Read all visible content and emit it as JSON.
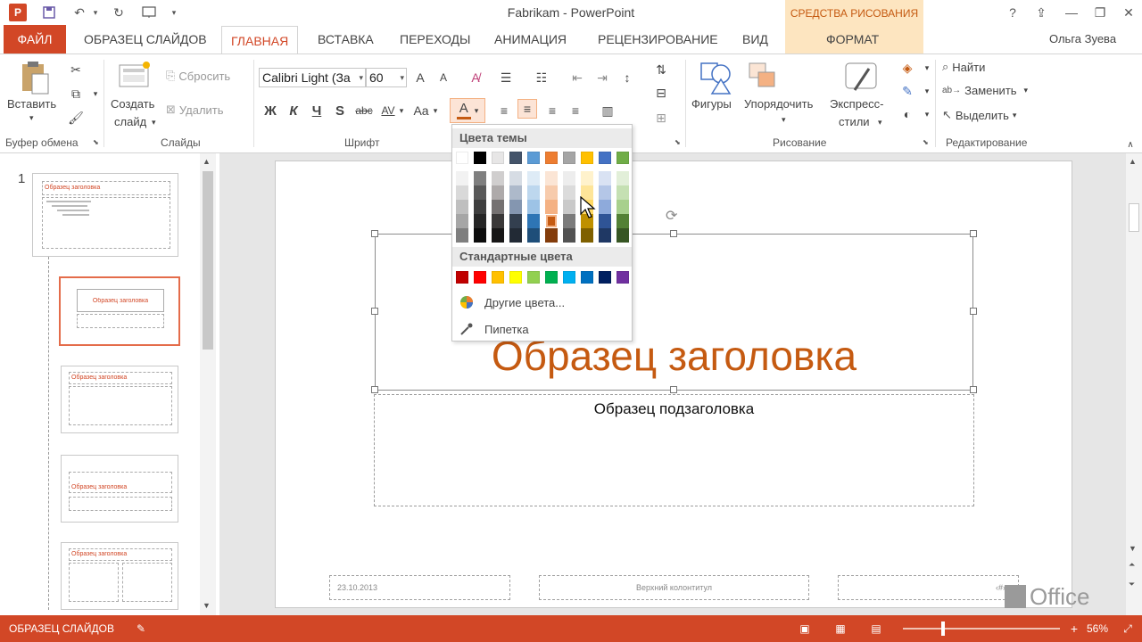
{
  "app": {
    "logo_letter": "P",
    "window_title": "Fabrikam - PowerPoint",
    "context_group": "СРЕДСТВА РИСОВАНИЯ",
    "user": "Ольга Зуева",
    "help": "?",
    "colors": {
      "accent": "#d24726",
      "title_orange": "#c55a11",
      "context_bg": "#fde5c0"
    }
  },
  "tabs": [
    {
      "label": "ФАЙЛ"
    },
    {
      "label": "ОБРАЗЕЦ СЛАЙДОВ"
    },
    {
      "label": "ГЛАВНАЯ"
    },
    {
      "label": "ВСТАВКА"
    },
    {
      "label": "ПЕРЕХОДЫ"
    },
    {
      "label": "АНИМАЦИЯ"
    },
    {
      "label": "РЕЦЕНЗИРОВАНИЕ"
    },
    {
      "label": "ВИД"
    },
    {
      "label": "ФОРМАТ"
    }
  ],
  "ribbon": {
    "clipboard": {
      "paste": "Вставить",
      "label": "Буфер обмена"
    },
    "slides": {
      "new_slide_line1": "Создать",
      "new_slide_line2": "слайд",
      "reset": "Сбросить",
      "delete": "Удалить",
      "label": "Слайды"
    },
    "font": {
      "font_name": "Calibri Light (За",
      "font_size": "60",
      "grow": "A",
      "shrink": "A",
      "bold": "Ж",
      "italic": "К",
      "underline": "Ч",
      "shadow": "S",
      "strike": "abc",
      "spacing": "AV",
      "case": "Aa",
      "color_letter": "A",
      "label": "Шрифт"
    },
    "drawing": {
      "shapes": "Фигуры",
      "arrange": "Упорядочить",
      "quick_styles_line1": "Экспресс-",
      "quick_styles_line2": "стили",
      "label": "Рисование"
    },
    "editing": {
      "find": "Найти",
      "replace": "Заменить",
      "select": "Выделить",
      "label": "Редактирование"
    }
  },
  "color_menu": {
    "theme_heading": "Цвета темы",
    "standard_heading": "Стандартные цвета",
    "more_colors": "Другие цвета...",
    "eyedropper": "Пипетка",
    "theme_top_row": [
      "#ffffff",
      "#000000",
      "#e7e6e6",
      "#44546a",
      "#5b9bd5",
      "#ed7d31",
      "#a5a5a5",
      "#ffc000",
      "#4472c4",
      "#70ad47"
    ],
    "theme_shades": [
      [
        "#f2f2f2",
        "#d9d9d9",
        "#bfbfbf",
        "#a6a6a6",
        "#7f7f7f"
      ],
      [
        "#7f7f7f",
        "#595959",
        "#3f3f3f",
        "#262626",
        "#0d0d0d"
      ],
      [
        "#d0cece",
        "#aeaaaa",
        "#757171",
        "#3a3838",
        "#171616"
      ],
      [
        "#d6dce4",
        "#adb9ca",
        "#8496b0",
        "#333f4f",
        "#222a35"
      ],
      [
        "#deebf6",
        "#bdd7ee",
        "#9dc3e6",
        "#2e75b5",
        "#1e4e79"
      ],
      [
        "#fbe5d5",
        "#f7cbac",
        "#f4b183",
        "#c55a11",
        "#833c0b"
      ],
      [
        "#ededed",
        "#dbdbdb",
        "#c9c9c9",
        "#7b7b7b",
        "#525252"
      ],
      [
        "#fff2cc",
        "#fee599",
        "#ffd965",
        "#bf9000",
        "#7f6000"
      ],
      [
        "#d9e2f3",
        "#b4c6e7",
        "#8eaadb",
        "#2f5496",
        "#1f3864"
      ],
      [
        "#e2efd9",
        "#c5e0b3",
        "#a8d08d",
        "#538135",
        "#375623"
      ]
    ],
    "selected_swatch": "#c55a11",
    "standard_colors": [
      "#c00000",
      "#ff0000",
      "#ffc000",
      "#ffff00",
      "#92d050",
      "#00b050",
      "#00b0f0",
      "#0070c0",
      "#002060",
      "#7030a0"
    ]
  },
  "thumbnails": {
    "number": "1",
    "title_sample": "Образец заголовка"
  },
  "slide": {
    "title": "Образец заголовка",
    "subtitle": "Образец подзаголовка",
    "footer_date": "23.10.2013",
    "footer_center": "Верхний колонтитул",
    "footer_page": "‹#›"
  },
  "office_logo": "Office",
  "status": {
    "mode": "ОБРАЗЕЦ СЛАЙДОВ",
    "zoom": "56%",
    "zoom_minus": "−",
    "zoom_plus": "+"
  }
}
